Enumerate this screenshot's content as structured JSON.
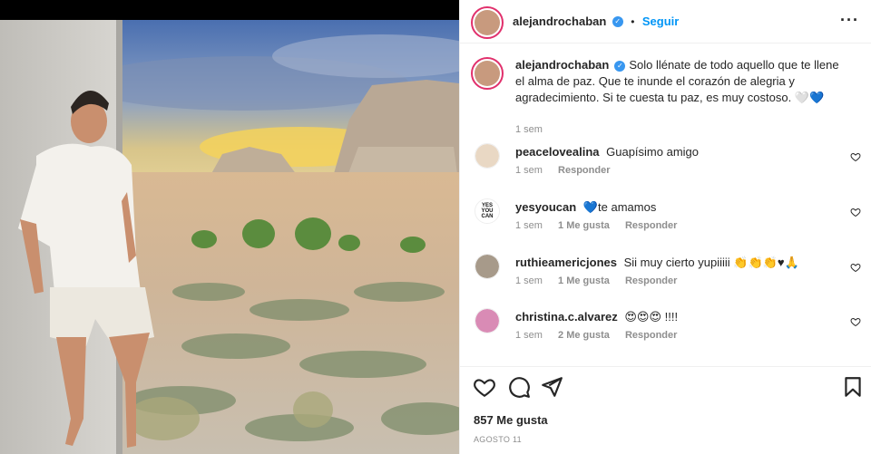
{
  "post": {
    "username": "alejandrochaban",
    "follow_label": "Seguir",
    "caption": "Solo llénate de todo aquello que te llene el alma de paz. Que te inunde el corazón de alegria y agradecimiento. Si te cuesta tu paz, es muy costoso. 🤍💙",
    "caption_time": "1 sem",
    "likes": "857 Me gusta",
    "date": "AGOSTO 11"
  },
  "comments": [
    {
      "username": "peacelovealina",
      "text": "Guapísimo amigo",
      "time": "1 sem",
      "likes": "",
      "reply": "Responder"
    },
    {
      "username": "yesyoucan",
      "text": "💙te amamos",
      "time": "1 sem",
      "likes": "1 Me gusta",
      "reply": "Responder"
    },
    {
      "username": "ruthieamericjones",
      "text": "Sii muy cierto yupiiiii 👏👏👏♥🙏",
      "time": "1 sem",
      "likes": "1 Me gusta",
      "reply": "Responder"
    },
    {
      "username": "christina.c.alvarez",
      "text": "😍😍😍 !!!!",
      "time": "1 sem",
      "likes": "2 Me gusta",
      "reply": "Responder"
    }
  ],
  "icons": {
    "more": "more-options-icon",
    "like": "heart-icon",
    "comment": "comment-icon",
    "share": "share-icon",
    "save": "bookmark-icon",
    "verified": "verified-badge-icon"
  },
  "colors": {
    "accent": "#0095f6",
    "verified": "#3897f0",
    "muted": "#8e8e8e",
    "text": "#262626"
  }
}
